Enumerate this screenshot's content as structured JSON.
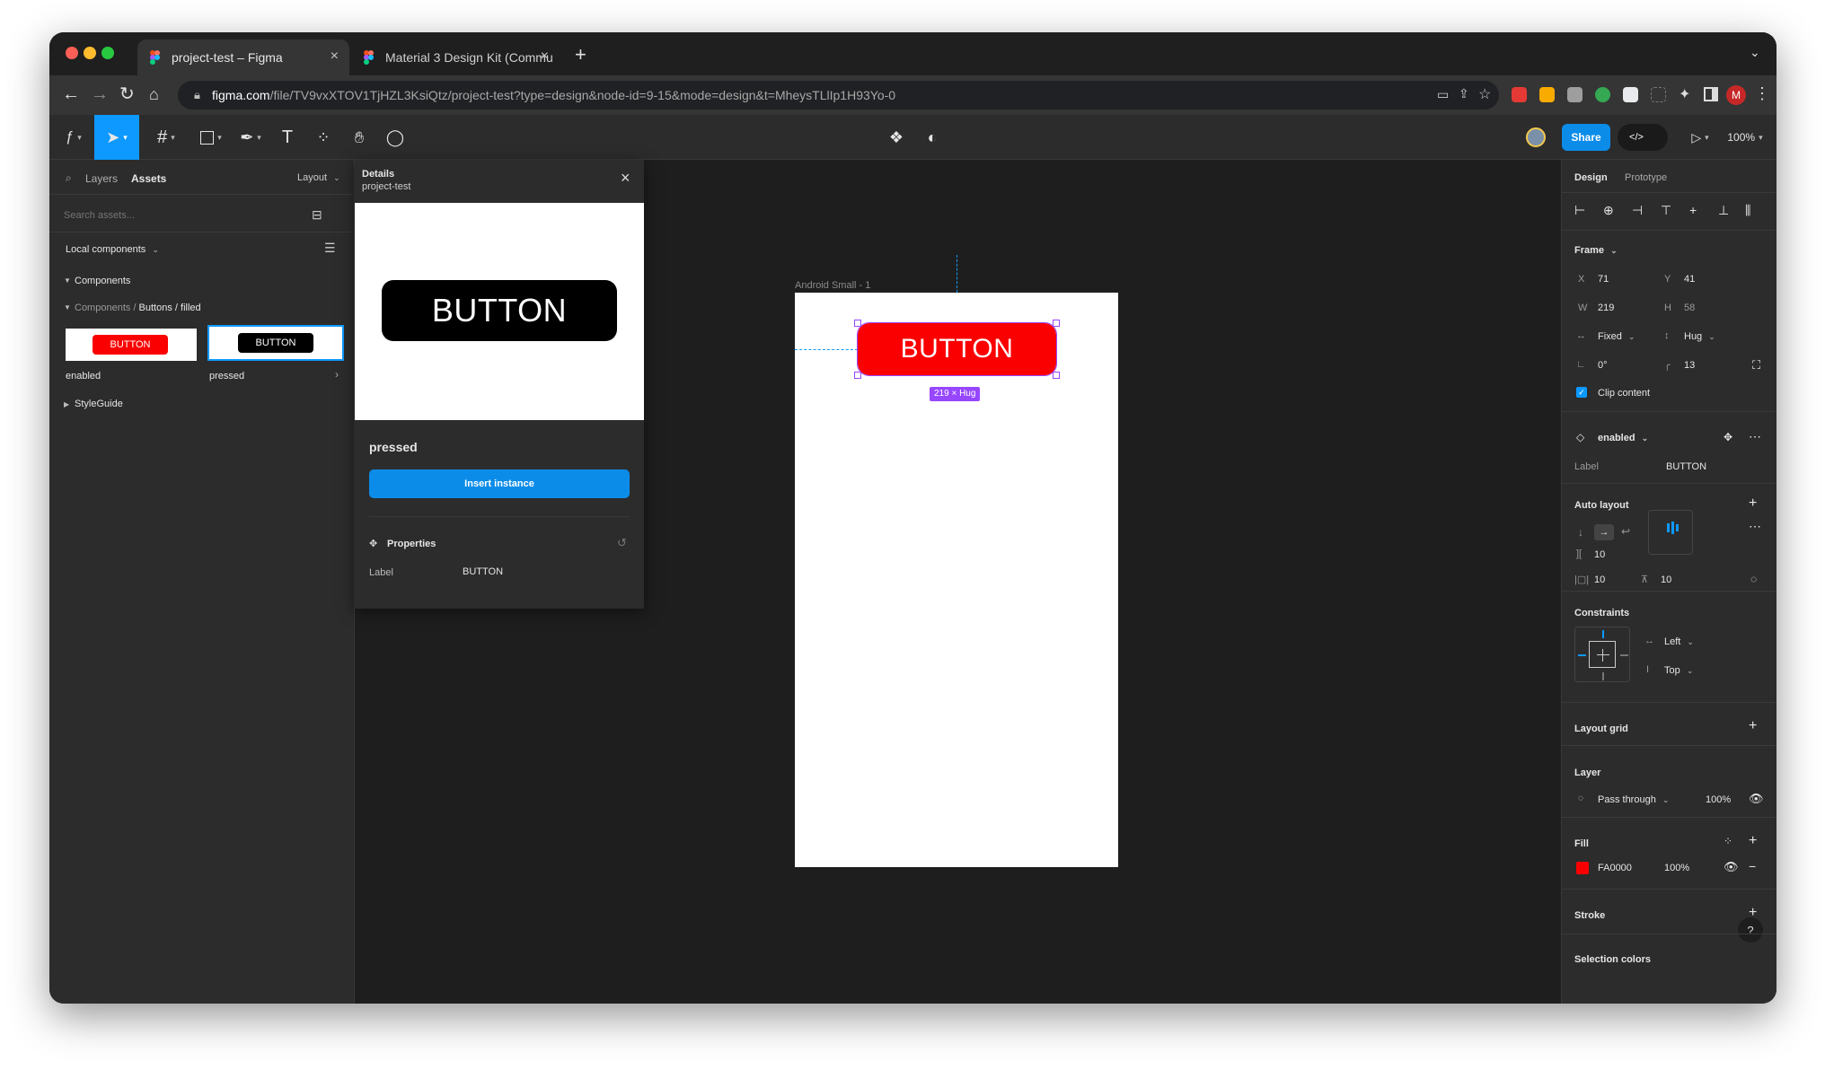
{
  "browser": {
    "tabs": [
      {
        "title": "project-test – Figma"
      },
      {
        "title": "Material 3 Design Kit (Commu"
      }
    ],
    "url_host": "figma.com",
    "url_path": "/file/TV9vxXTOV1TjHZL3KsiQtz/project-test?type=design&node-id=9-15&mode=design&t=MheysTLlIp1H93Yo-0",
    "profile_initial": "M"
  },
  "toolbar": {
    "share_label": "Share",
    "code_label": "</>",
    "zoom": "100%"
  },
  "left_panel": {
    "tab_layers": "Layers",
    "tab_assets": "Assets",
    "layout_label": "Layout",
    "search_placeholder": "Search assets...",
    "local_components": "Local components",
    "components_group": "Components",
    "breadcrumb_parent": "Components /",
    "breadcrumb_current": "Buttons / filled",
    "thumb_text": "BUTTON",
    "thumbs": [
      {
        "label": "enabled"
      },
      {
        "label": "pressed"
      }
    ],
    "styleguide": "StyleGuide"
  },
  "details": {
    "title": "Details",
    "subtitle": "project-test",
    "preview_text": "BUTTON",
    "component_name": "pressed",
    "insert_label": "Insert instance",
    "properties_title": "Properties",
    "prop_label": "Label",
    "prop_value": "BUTTON"
  },
  "canvas": {
    "frame_name": "Android Small - 1",
    "button_text": "BUTTON",
    "size_badge": "219 × Hug"
  },
  "right_panel": {
    "tab_design": "Design",
    "tab_prototype": "Prototype",
    "frame_title": "Frame",
    "x_label": "X",
    "x": "71",
    "y_label": "Y",
    "y": "41",
    "w_label": "W",
    "w": "219",
    "h_label": "H",
    "h": "58",
    "width_mode": "Fixed",
    "height_mode": "Hug",
    "rotation": "0°",
    "radius": "13",
    "clip_content": "Clip content",
    "component_variant": "enabled",
    "label_prop": "Label",
    "label_value": "BUTTON",
    "auto_layout_title": "Auto layout",
    "gap": "10",
    "pad_h": "10",
    "pad_v": "10",
    "constraints_title": "Constraints",
    "constraint_h": "Left",
    "constraint_v": "Top",
    "layout_grid_title": "Layout grid",
    "layer_title": "Layer",
    "blend_mode": "Pass through",
    "layer_opacity": "100%",
    "fill_title": "Fill",
    "fill_hex": "FA0000",
    "fill_opacity": "100%",
    "stroke_title": "Stroke",
    "selection_colors_title": "Selection colors",
    "help": "?"
  },
  "colors": {
    "accent": "#0d99ff",
    "share_blue": "#0c8ce9",
    "button_red": "#fa0000",
    "selection_purple": "#9747ff"
  }
}
